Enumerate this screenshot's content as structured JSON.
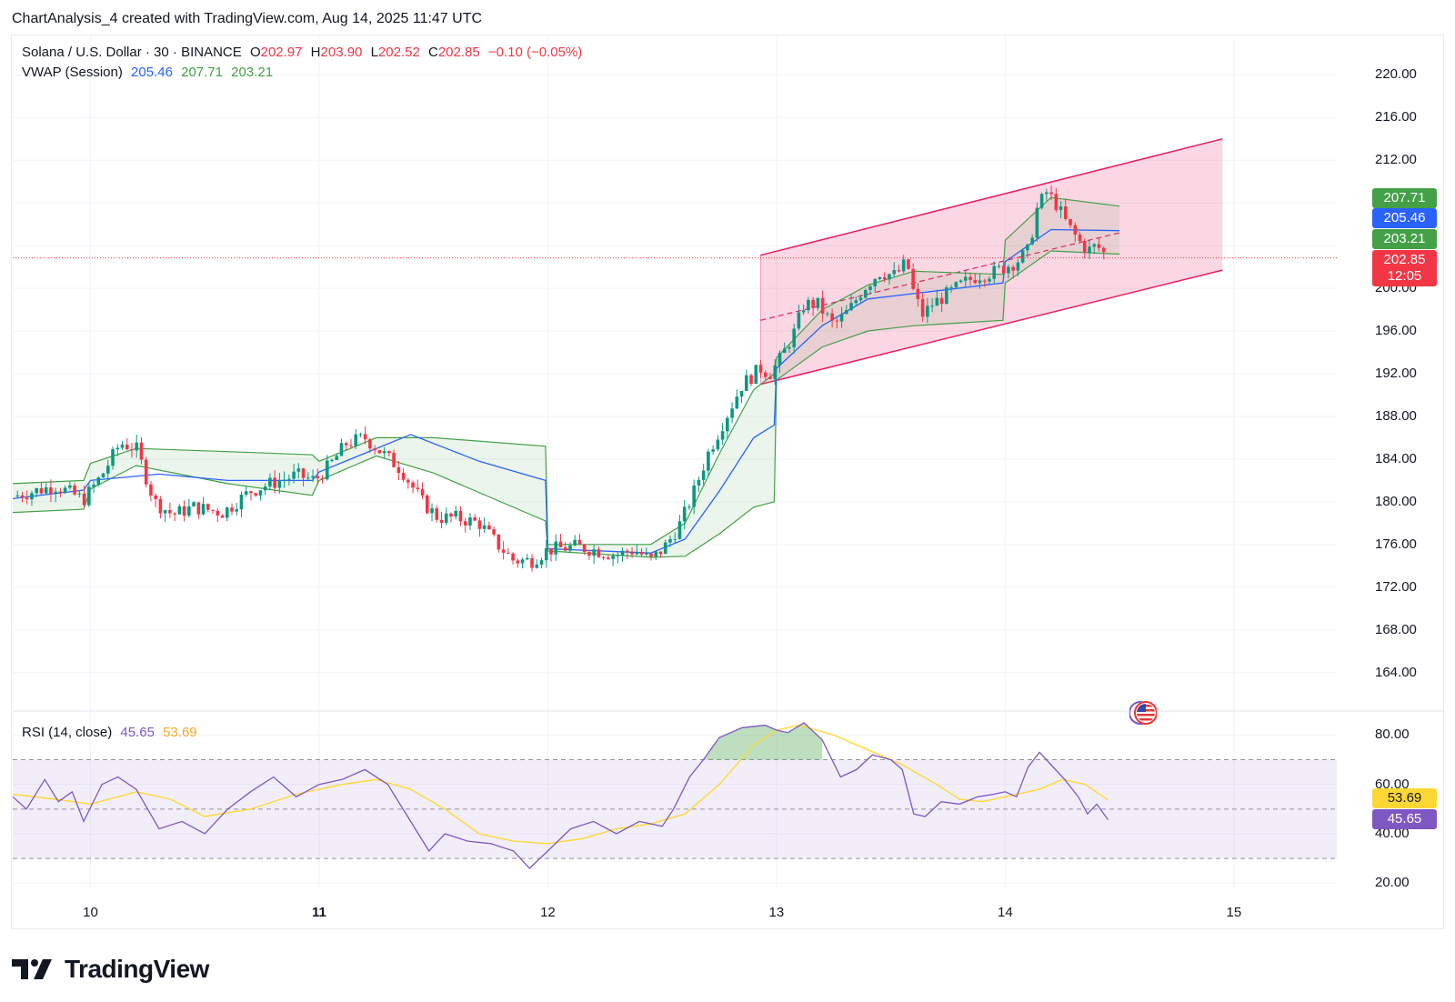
{
  "header": {
    "text": "ChartAnalysis_4 created with TradingView.com, Aug 14, 2025 11:47 UTC"
  },
  "legend": {
    "symbol": "Solana / U.S. Dollar · 30 · BINANCE",
    "open_label": "O",
    "open": "202.97",
    "high_label": "H",
    "high": "203.90",
    "low_label": "L",
    "low": "202.52",
    "close_label": "C",
    "close": "202.85",
    "change": "−0.10 (−0.05%)",
    "vwap_label": "VWAP (Session)",
    "vwap_values": [
      "205.46",
      "207.71",
      "203.21"
    ],
    "rsi_label": "RSI (14, close)",
    "rsi_values": [
      "45.65",
      "53.69"
    ]
  },
  "badges": {
    "upper": "207.71",
    "vwap": "205.46",
    "lower": "203.21",
    "price": "202.85",
    "countdown": "12:05",
    "rsi_ma": "53.69",
    "rsi": "45.65"
  },
  "colors": {
    "up": "#089981",
    "down": "#f23645",
    "vwap": "#2962ff",
    "band": "#43a047",
    "channel": "#e91e63",
    "rsi": "#7e57c2",
    "rsi_ma": "#fdd835",
    "text_green": "#43a047",
    "text_blue": "#2962ff"
  },
  "brand": {
    "logo_text": "TradingView",
    "logo_icon": "tradingview-logo-icon",
    "flag_icon": "us-flag-icon"
  },
  "chart_data": [
    {
      "type": "candlestick",
      "title": "Solana / U.S. Dollar · 30 · BINANCE",
      "x_tick_labels": [
        "10",
        "11",
        "12",
        "13",
        "14",
        "15"
      ],
      "y_tick_labels": [
        "220.00",
        "216.00",
        "212.00",
        "208.00",
        "204.00",
        "200.00",
        "196.00",
        "192.00",
        "188.00",
        "184.00",
        "180.00",
        "176.00",
        "172.00",
        "168.00",
        "164.00"
      ],
      "ylim": [
        160.4,
        223.6
      ],
      "xlim": [
        9.66,
        15.45
      ],
      "grid": true,
      "last_price": 202.85,
      "price_path": [
        [
          9.66,
          180.5
        ],
        [
          9.85,
          181.5
        ],
        [
          9.97,
          180.2
        ],
        [
          10.05,
          182.5
        ],
        [
          10.13,
          185.5
        ],
        [
          10.2,
          185.0
        ],
        [
          10.28,
          180.0
        ],
        [
          10.36,
          178.8
        ],
        [
          10.45,
          179.5
        ],
        [
          10.58,
          179.0
        ],
        [
          10.7,
          181.0
        ],
        [
          10.8,
          181.8
        ],
        [
          10.9,
          182.5
        ],
        [
          10.98,
          182.0
        ],
        [
          11.05,
          183.5
        ],
        [
          11.12,
          185.5
        ],
        [
          11.2,
          186.0
        ],
        [
          11.28,
          184.5
        ],
        [
          11.36,
          183.0
        ],
        [
          11.45,
          180.0
        ],
        [
          11.52,
          178.5
        ],
        [
          11.6,
          178.5
        ],
        [
          11.7,
          178.0
        ],
        [
          11.78,
          176.0
        ],
        [
          11.85,
          174.5
        ],
        [
          11.93,
          174.5
        ],
        [
          12.0,
          175.5
        ],
        [
          12.12,
          175.8
        ],
        [
          12.2,
          175.5
        ],
        [
          12.3,
          175.0
        ],
        [
          12.38,
          175.5
        ],
        [
          12.45,
          174.5
        ],
        [
          12.52,
          176.0
        ],
        [
          12.58,
          178.0
        ],
        [
          12.64,
          181.0
        ],
        [
          12.7,
          184.5
        ],
        [
          12.78,
          188.0
        ],
        [
          12.85,
          191.0
        ],
        [
          12.93,
          192.5
        ],
        [
          12.97,
          192.0
        ],
        [
          13.02,
          193.5
        ],
        [
          13.08,
          196.0
        ],
        [
          13.12,
          198.5
        ],
        [
          13.18,
          198.5
        ],
        [
          13.25,
          196.5
        ],
        [
          13.32,
          198.0
        ],
        [
          13.38,
          200.0
        ],
        [
          13.45,
          201.5
        ],
        [
          13.52,
          201.2
        ],
        [
          13.57,
          202.5
        ],
        [
          13.6,
          199.5
        ],
        [
          13.64,
          197.5
        ],
        [
          13.68,
          198.5
        ],
        [
          13.75,
          199.5
        ],
        [
          13.82,
          200.5
        ],
        [
          13.88,
          201.2
        ],
        [
          13.95,
          201.5
        ],
        [
          14.0,
          202.0
        ],
        [
          14.05,
          202.5
        ],
        [
          14.1,
          203.5
        ],
        [
          14.14,
          207.5
        ],
        [
          14.18,
          209.0
        ],
        [
          14.22,
          208.0
        ],
        [
          14.27,
          206.0
        ],
        [
          14.32,
          204.5
        ],
        [
          14.36,
          203.5
        ],
        [
          14.4,
          204.0
        ],
        [
          14.45,
          202.85
        ]
      ],
      "channel": {
        "upper": [
          [
            12.93,
            203.1
          ],
          [
            14.95,
            214.0
          ]
        ],
        "lower": [
          [
            12.93,
            191.0
          ],
          [
            14.95,
            201.7
          ]
        ],
        "mid": [
          [
            12.93,
            197.0
          ],
          [
            14.5,
            205.2
          ]
        ]
      },
      "vwap_session": {
        "name": "VWAP (Session)",
        "last_values": {
          "vwap": 205.46,
          "upper": 207.71,
          "lower": 203.21
        },
        "vwap": [
          [
            9.66,
            180.3
          ],
          [
            9.97,
            181.1
          ],
          [
            10.0,
            182.0
          ],
          [
            10.3,
            182.6
          ],
          [
            10.6,
            182.0
          ],
          [
            10.97,
            182.0
          ],
          [
            11.0,
            182.8
          ],
          [
            11.4,
            186.3
          ],
          [
            11.7,
            183.8
          ],
          [
            11.99,
            182.0
          ],
          [
            12.0,
            175.6
          ],
          [
            12.45,
            175.2
          ],
          [
            12.6,
            176.5
          ],
          [
            12.75,
            181.0
          ],
          [
            12.9,
            186.0
          ],
          [
            12.99,
            187.2
          ],
          [
            13.0,
            192.5
          ],
          [
            13.2,
            196.5
          ],
          [
            13.4,
            199.0
          ],
          [
            13.6,
            199.5
          ],
          [
            13.99,
            200.5
          ],
          [
            14.0,
            202.5
          ],
          [
            14.2,
            205.5
          ],
          [
            14.5,
            205.4
          ]
        ],
        "upper": [
          [
            9.66,
            181.7
          ],
          [
            9.97,
            182.0
          ],
          [
            10.0,
            183.6
          ],
          [
            10.2,
            185.0
          ],
          [
            10.6,
            184.7
          ],
          [
            10.97,
            184.4
          ],
          [
            11.0,
            183.8
          ],
          [
            11.25,
            186.0
          ],
          [
            11.5,
            186.0
          ],
          [
            11.99,
            185.2
          ],
          [
            12.0,
            176.0
          ],
          [
            12.45,
            176.0
          ],
          [
            12.6,
            178.0
          ],
          [
            12.75,
            184.5
          ],
          [
            12.9,
            190.5
          ],
          [
            12.99,
            192.0
          ],
          [
            13.0,
            193.5
          ],
          [
            13.2,
            198.0
          ],
          [
            13.4,
            200.3
          ],
          [
            13.6,
            201.6
          ],
          [
            13.99,
            201.3
          ],
          [
            14.0,
            204.5
          ],
          [
            14.2,
            208.5
          ],
          [
            14.5,
            207.7
          ]
        ],
        "lower": [
          [
            9.66,
            179.0
          ],
          [
            9.97,
            179.3
          ],
          [
            10.0,
            181.2
          ],
          [
            10.2,
            183.4
          ],
          [
            10.6,
            181.7
          ],
          [
            10.97,
            180.6
          ],
          [
            11.0,
            182.0
          ],
          [
            11.25,
            184.3
          ],
          [
            11.5,
            182.7
          ],
          [
            11.99,
            178.2
          ],
          [
            12.0,
            175.4
          ],
          [
            12.45,
            174.8
          ],
          [
            12.6,
            174.9
          ],
          [
            12.75,
            177.0
          ],
          [
            12.9,
            179.5
          ],
          [
            12.99,
            180.0
          ],
          [
            13.0,
            191.4
          ],
          [
            13.2,
            194.5
          ],
          [
            13.4,
            196.0
          ],
          [
            13.6,
            196.5
          ],
          [
            13.99,
            197.0
          ],
          [
            14.0,
            200.5
          ],
          [
            14.2,
            203.5
          ],
          [
            14.5,
            203.2
          ]
        ]
      }
    },
    {
      "type": "line",
      "title": "RSI (14, close)",
      "y_tick_labels": [
        "80.00",
        "60.00",
        "40.00",
        "20.00"
      ],
      "ylim": [
        17.5,
        89.0
      ],
      "bands": {
        "upper": 70,
        "middle": 50,
        "lower": 30
      },
      "series": [
        {
          "name": "RSI",
          "last": 45.65,
          "values": [
            [
              9.66,
              55
            ],
            [
              9.72,
              50
            ],
            [
              9.8,
              62
            ],
            [
              9.86,
              53
            ],
            [
              9.92,
              57
            ],
            [
              9.97,
              45
            ],
            [
              10.05,
              60
            ],
            [
              10.12,
              63
            ],
            [
              10.2,
              58
            ],
            [
              10.3,
              42
            ],
            [
              10.4,
              45
            ],
            [
              10.5,
              40
            ],
            [
              10.6,
              50
            ],
            [
              10.7,
              57
            ],
            [
              10.8,
              63
            ],
            [
              10.9,
              55
            ],
            [
              11.0,
              60
            ],
            [
              11.1,
              62
            ],
            [
              11.2,
              66
            ],
            [
              11.3,
              60
            ],
            [
              11.4,
              45
            ],
            [
              11.48,
              33
            ],
            [
              11.55,
              40
            ],
            [
              11.65,
              37
            ],
            [
              11.75,
              36
            ],
            [
              11.85,
              33
            ],
            [
              11.92,
              26
            ],
            [
              12.0,
              33
            ],
            [
              12.1,
              42
            ],
            [
              12.2,
              45
            ],
            [
              12.3,
              40
            ],
            [
              12.4,
              45
            ],
            [
              12.5,
              43
            ],
            [
              12.55,
              50
            ],
            [
              12.62,
              63
            ],
            [
              12.68,
              70
            ],
            [
              12.75,
              79
            ],
            [
              12.85,
              83
            ],
            [
              12.95,
              84
            ],
            [
              13.0,
              82
            ],
            [
              13.05,
              81
            ],
            [
              13.12,
              85
            ],
            [
              13.2,
              78
            ],
            [
              13.28,
              63
            ],
            [
              13.35,
              66
            ],
            [
              13.42,
              72
            ],
            [
              13.5,
              70
            ],
            [
              13.55,
              66
            ],
            [
              13.6,
              48
            ],
            [
              13.65,
              47
            ],
            [
              13.72,
              53
            ],
            [
              13.8,
              52
            ],
            [
              13.88,
              55
            ],
            [
              13.95,
              56
            ],
            [
              14.0,
              57
            ],
            [
              14.05,
              55
            ],
            [
              14.1,
              67
            ],
            [
              14.15,
              73
            ],
            [
              14.2,
              68
            ],
            [
              14.26,
              62
            ],
            [
              14.32,
              55
            ],
            [
              14.36,
              48
            ],
            [
              14.4,
              52
            ],
            [
              14.45,
              45.65
            ]
          ]
        },
        {
          "name": "RSI-based MA",
          "last": 53.69,
          "values": [
            [
              9.66,
              56
            ],
            [
              9.85,
              54
            ],
            [
              10.0,
              52
            ],
            [
              10.2,
              57
            ],
            [
              10.35,
              54
            ],
            [
              10.5,
              47
            ],
            [
              10.7,
              50
            ],
            [
              10.9,
              56
            ],
            [
              11.1,
              60
            ],
            [
              11.25,
              62
            ],
            [
              11.4,
              58
            ],
            [
              11.55,
              50
            ],
            [
              11.7,
              40
            ],
            [
              11.85,
              37
            ],
            [
              12.0,
              36
            ],
            [
              12.15,
              38
            ],
            [
              12.3,
              42
            ],
            [
              12.45,
              44
            ],
            [
              12.6,
              48
            ],
            [
              12.75,
              60
            ],
            [
              12.9,
              76
            ],
            [
              13.0,
              82
            ],
            [
              13.1,
              84
            ],
            [
              13.25,
              80
            ],
            [
              13.4,
              74
            ],
            [
              13.55,
              68
            ],
            [
              13.7,
              60
            ],
            [
              13.8,
              54
            ],
            [
              13.9,
              53
            ],
            [
              14.0,
              55
            ],
            [
              14.15,
              58
            ],
            [
              14.25,
              62
            ],
            [
              14.35,
              60
            ],
            [
              14.45,
              53.69
            ]
          ]
        }
      ]
    }
  ]
}
